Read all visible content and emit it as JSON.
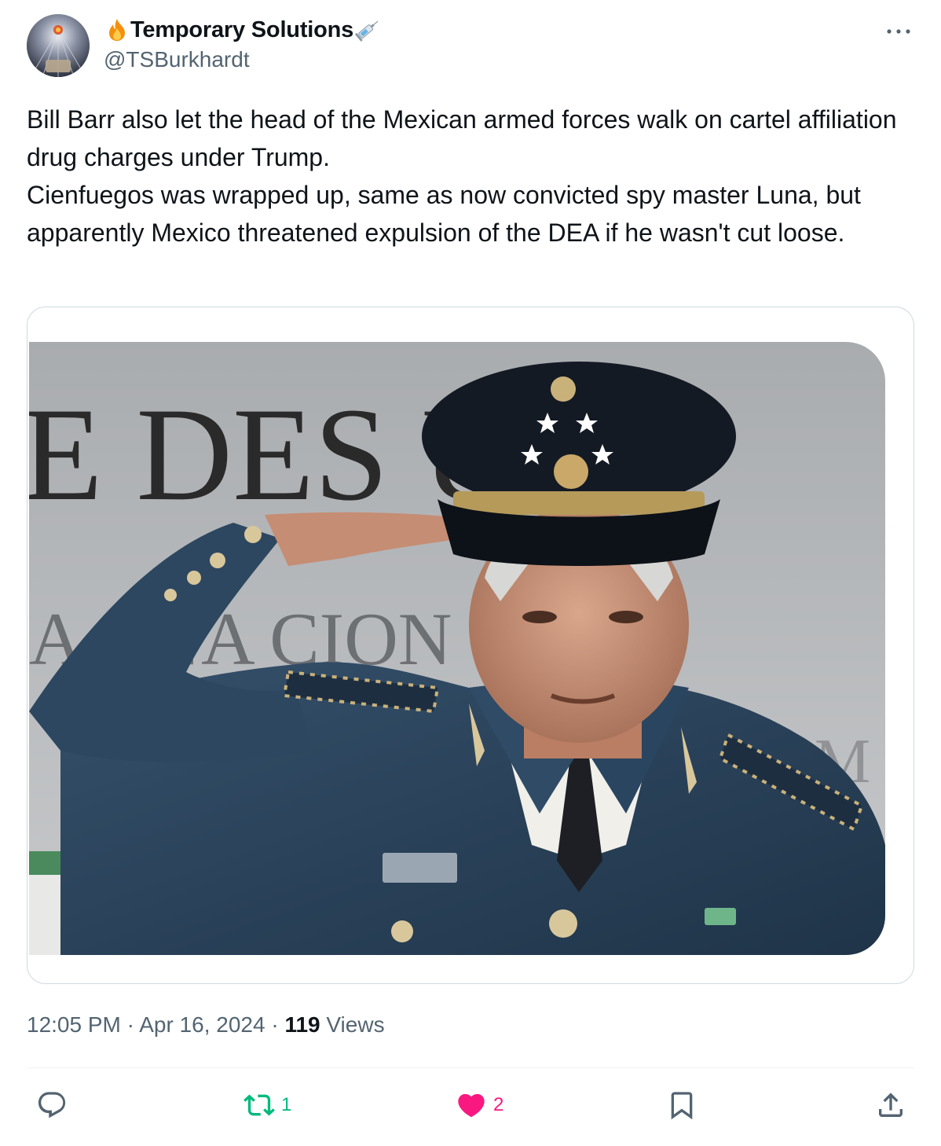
{
  "author": {
    "display_name": "Temporary Solutions",
    "handle": "@TSBurkhardt",
    "emoji_before": "fire-emoji",
    "emoji_after": "syringe-emoji"
  },
  "tweet": {
    "paragraphs": [
      "Bill Barr also let the head of the Mexican armed forces walk on cartel affiliation drug charges under Trump.",
      "Cienfuegos was wrapped up, same as now convicted spy master Luna, but apparently Mexico threatened expulsion of the DEA if he wasn't cut loose."
    ]
  },
  "media": {
    "sign_text_top": "E DES    UC",
    "sign_text_mid": "A  AÑA    CION",
    "sign_text_low": "M"
  },
  "meta": {
    "time": "12:05 PM",
    "separator": "·",
    "date": "Apr 16, 2024",
    "views_count": "119",
    "views_label": "Views"
  },
  "actions": {
    "reply_count": "",
    "retweet_count": "1",
    "like_count": "2",
    "retweet_color": "#00ba7c",
    "like_color": "#f91880"
  }
}
